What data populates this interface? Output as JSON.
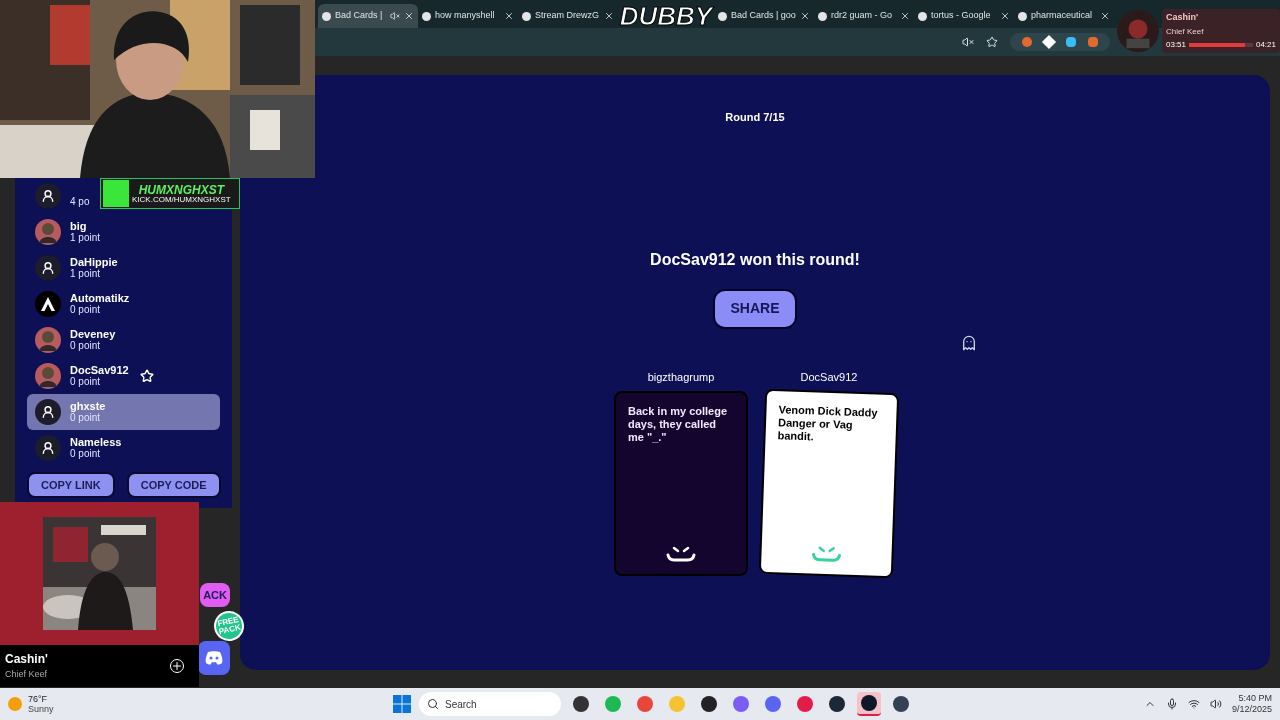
{
  "browser": {
    "tabs": [
      {
        "title": "Bad Cards |",
        "selected": true,
        "muted": true
      },
      {
        "title": "how manyshell",
        "selected": false,
        "muted": false
      },
      {
        "title": "Stream DrewzG",
        "selected": false,
        "muted": false
      },
      {
        "title": "Bad Cards | goo",
        "selected": false,
        "muted": false
      },
      {
        "title": "rdr2 guam - Go",
        "selected": false,
        "muted": false
      },
      {
        "title": "tortus - Google",
        "selected": false,
        "muted": false
      },
      {
        "title": "pharmaceutical",
        "selected": false,
        "muted": false
      }
    ]
  },
  "overlays": {
    "stream_logo": "DUBBY",
    "streamer_badge": {
      "name": "HUMXNGHXST",
      "link": "KICK.COM/HUMXNGHXST"
    },
    "now_playing_top": {
      "title": "Cashin'",
      "artist": "Chief Keef",
      "elapsed": "03:51",
      "total": "04:21",
      "level": 0.88
    },
    "now_playing": {
      "title": "Cashin'",
      "artist": "Chief Keef"
    }
  },
  "sidebar": {
    "players": [
      {
        "points": "4 po",
        "kind": "default",
        "selected": false,
        "winner": false
      },
      {
        "name": "big",
        "points": "1 point",
        "kind": "picture",
        "selected": false,
        "winner": false
      },
      {
        "name": "DaHippie",
        "points": "1 point",
        "kind": "default",
        "selected": false,
        "winner": false
      },
      {
        "name": "Automatikz",
        "points": "0 point",
        "kind": "logo",
        "selected": false,
        "winner": false
      },
      {
        "name": "Deveney",
        "points": "0 point",
        "kind": "picture",
        "selected": false,
        "winner": false
      },
      {
        "name": "DocSav912",
        "points": "0 point",
        "kind": "picture",
        "selected": false,
        "winner": true
      },
      {
        "name": "ghxste",
        "points": "0 point",
        "kind": "default",
        "selected": true,
        "winner": false
      },
      {
        "name": "Nameless",
        "points": "0 point",
        "kind": "default",
        "selected": false,
        "winner": false
      }
    ],
    "buttons": [
      "COPY LINK",
      "COPY CODE"
    ],
    "pack_button": "ACK",
    "free_badge": "FREE PACK"
  },
  "game": {
    "round": "Round 7/15",
    "result": "DocSav912 won this round!",
    "share": "SHARE",
    "cards": [
      {
        "player": "bigzthagrump",
        "text": "Back in my college days, they called me \"_.\"",
        "kind": "prompt"
      },
      {
        "player": "DocSav912",
        "text": "Venom Dick Daddy Danger or Vag bandit.",
        "kind": "answer"
      }
    ]
  },
  "taskbar": {
    "weather": {
      "temp": "76°F",
      "condition": "Sunny"
    },
    "search": {
      "placeholder": "Search"
    },
    "apps": [
      {
        "kind": "files",
        "selected": false
      },
      {
        "kind": "spotify",
        "selected": false
      },
      {
        "kind": "chrome",
        "selected": false
      },
      {
        "kind": "folder",
        "selected": false
      },
      {
        "kind": "obs",
        "selected": false
      },
      {
        "kind": "circle",
        "selected": false
      },
      {
        "kind": "discord",
        "selected": false
      },
      {
        "kind": "red",
        "selected": false
      },
      {
        "kind": "steam",
        "selected": false
      },
      {
        "kind": "monitor",
        "selected": true
      },
      {
        "kind": "notes",
        "selected": false
      }
    ],
    "time": "5:40 PM",
    "date": "9/12/2025"
  }
}
